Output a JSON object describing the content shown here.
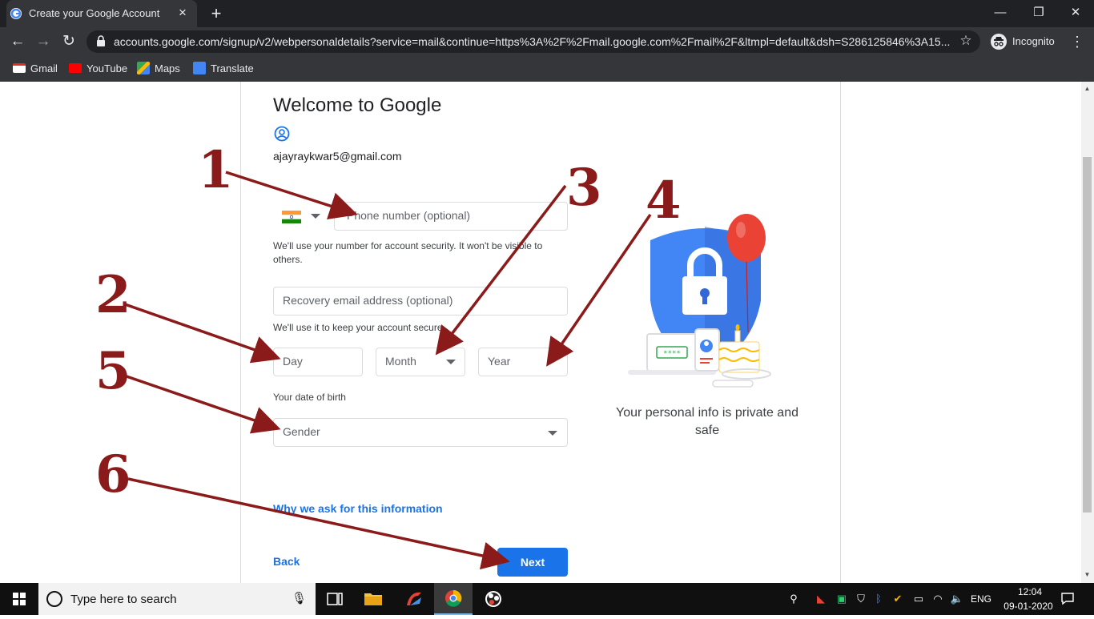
{
  "browser": {
    "tab_title": "Create your Google Account",
    "url": "accounts.google.com/signup/v2/webpersonaldetails?service=mail&continue=https%3A%2F%2Fmail.google.com%2Fmail%2F&ltmpl=default&dsh=S286125846%3A15...",
    "profile_label": "Incognito",
    "bookmarks": [
      {
        "label": "Gmail",
        "icon": "gmail-icon"
      },
      {
        "label": "YouTube",
        "icon": "youtube-icon"
      },
      {
        "label": "Maps",
        "icon": "maps-icon"
      },
      {
        "label": "Translate",
        "icon": "translate-icon"
      }
    ]
  },
  "form": {
    "title": "Welcome to Google",
    "email": "ajayraykwar5@gmail.com",
    "phone_placeholder": "Phone number (optional)",
    "phone_help": "We'll use your number for account security. It won't be visible to others.",
    "recovery_placeholder": "Recovery email address (optional)",
    "recovery_help": "We'll use it to keep your account secure",
    "day_placeholder": "Day",
    "month_placeholder": "Month",
    "year_placeholder": "Year",
    "dob_help": "Your date of birth",
    "gender_placeholder": "Gender",
    "why_link": "Why we ask for this information",
    "back_label": "Back",
    "next_label": "Next"
  },
  "illustration": {
    "card_text": "****",
    "caption": "Your personal info is private and safe"
  },
  "annotations": [
    "1",
    "2",
    "3",
    "4",
    "5",
    "6"
  ],
  "taskbar": {
    "search_placeholder": "Type here to search",
    "language": "ENG",
    "time": "12:04",
    "date": "09-01-2020"
  },
  "colors": {
    "accent": "#1a73e8",
    "annotation": "#8b1a1a",
    "chrome_dark": "#202124"
  }
}
